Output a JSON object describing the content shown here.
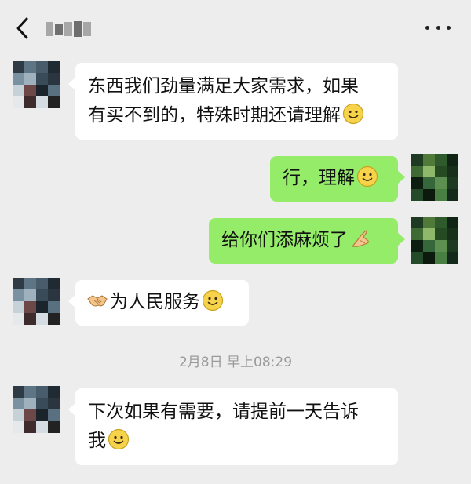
{
  "header": {
    "back_icon": "chevron-left-icon",
    "contact_name_blurred": true,
    "more_icon": "more-dots-icon"
  },
  "messages": [
    {
      "side": "left",
      "lines": [
        "东西我们劲量满足大家需求，如果",
        "有买不到的，特殊时期还请理解"
      ],
      "trailing_emoji": "smile-emoji"
    },
    {
      "side": "right",
      "lines": [
        "行，理解"
      ],
      "trailing_emoji": "smile-emoji"
    },
    {
      "side": "right",
      "lines": [
        "给你们添麻烦了"
      ],
      "trailing_emoji": "pray-hands-emoji"
    },
    {
      "side": "left",
      "leading_emoji": "handshake-emoji",
      "lines": [
        "为人民服务"
      ],
      "trailing_emoji": "smile-emoji"
    },
    {
      "side": "left",
      "lines": [
        "下次如果有需要，请提前一天告诉",
        "我"
      ],
      "trailing_emoji": "smile-emoji"
    }
  ],
  "timestamp": "2月8日 早上08:29",
  "colors": {
    "background": "#ededed",
    "incoming_bubble": "#ffffff",
    "outgoing_bubble": "#95ec69",
    "timestamp_text": "#9a9a9a"
  }
}
